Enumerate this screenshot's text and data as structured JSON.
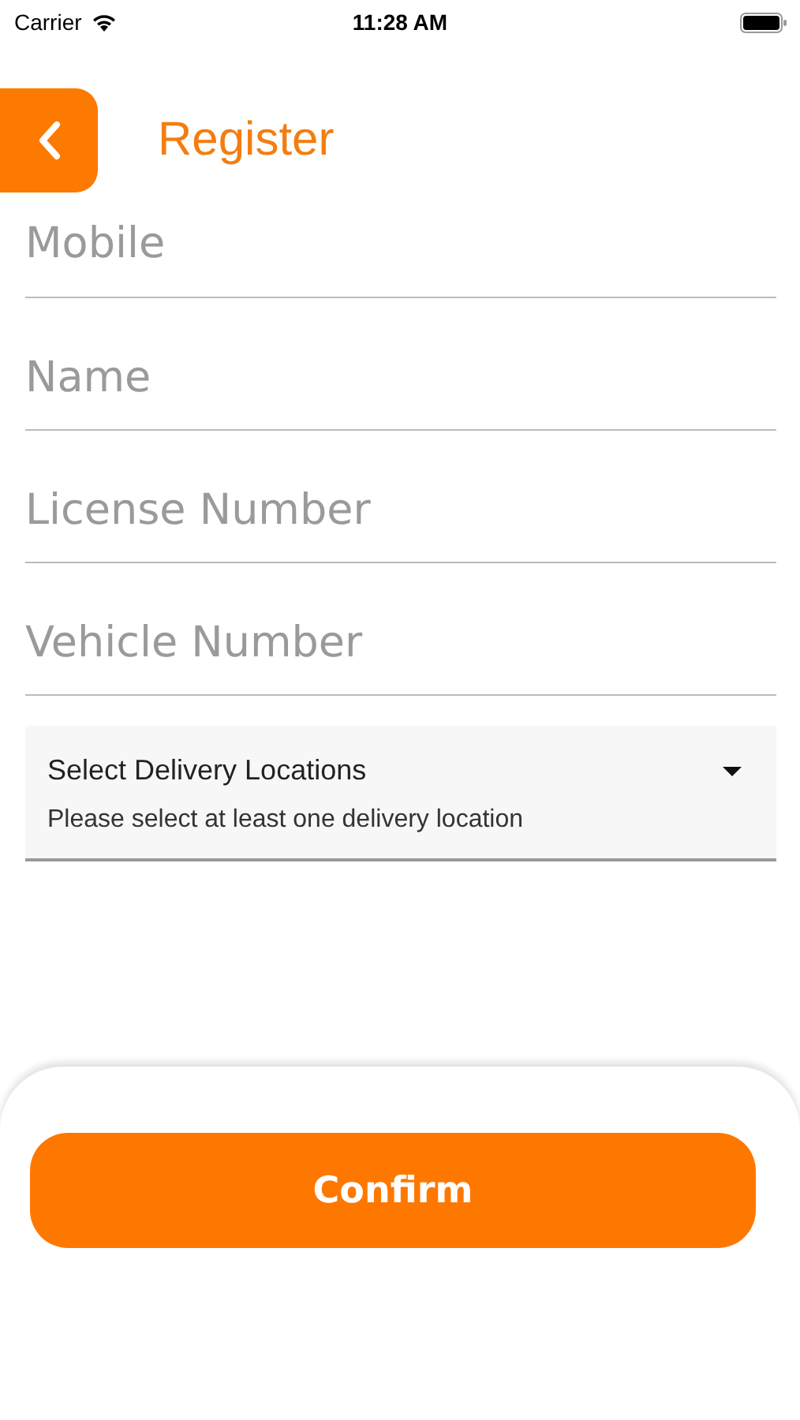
{
  "status_bar": {
    "carrier": "Carrier",
    "time": "11:28 AM"
  },
  "header": {
    "title": "Register"
  },
  "fields": [
    {
      "placeholder": "Mobile"
    },
    {
      "placeholder": "Name"
    },
    {
      "placeholder": "License Number"
    },
    {
      "placeholder": "Vehicle Number"
    }
  ],
  "dropdown": {
    "label": "Select Delivery Locations",
    "helper": "Please select at least one delivery location"
  },
  "confirm_button": "Confirm"
}
